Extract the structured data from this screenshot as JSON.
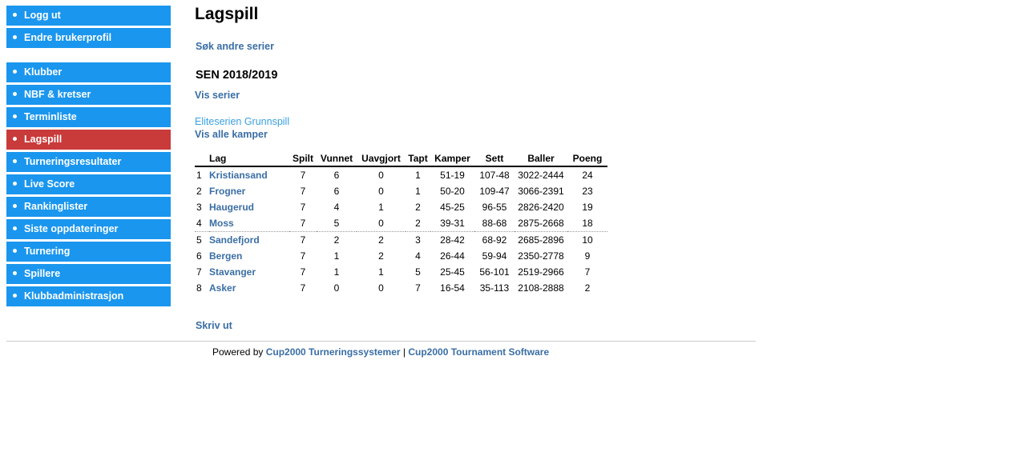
{
  "sidebar": {
    "top_items": [
      {
        "label": "Logg ut"
      },
      {
        "label": "Endre brukerprofil"
      }
    ],
    "items": [
      {
        "label": "Klubber"
      },
      {
        "label": "NBF & kretser"
      },
      {
        "label": "Terminliste"
      },
      {
        "label": "Lagspill",
        "active": true
      },
      {
        "label": "Turneringsresultater"
      },
      {
        "label": "Live Score"
      },
      {
        "label": "Rankinglister"
      },
      {
        "label": "Siste oppdateringer"
      },
      {
        "label": "Turnering"
      },
      {
        "label": "Spillere"
      },
      {
        "label": "Klubbadministrasjon"
      }
    ],
    "colors": {
      "item": "#1a96ee",
      "active": "#c93a3a"
    }
  },
  "main": {
    "title": "Lagspill",
    "search_other_series": "Søk andre serier",
    "season": "SEN 2018/2019",
    "show_series": "Vis serier",
    "series_name": "Eliteserien Grunnspill",
    "show_all_matches": "Vis alle kamper",
    "print": "Skriv ut"
  },
  "standings": {
    "headers": [
      "",
      "Lag",
      "Spilt",
      "Vunnet",
      "Uavgjort",
      "Tapt",
      "Kamper",
      "Sett",
      "Baller",
      "Poeng"
    ],
    "rows": [
      [
        "1",
        "Kristiansand",
        "7",
        "6",
        "0",
        "1",
        "51-19",
        "107-48",
        "3022-2444",
        "24"
      ],
      [
        "2",
        "Frogner",
        "7",
        "6",
        "0",
        "1",
        "50-20",
        "109-47",
        "3066-2391",
        "23"
      ],
      [
        "3",
        "Haugerud",
        "7",
        "4",
        "1",
        "2",
        "45-25",
        "96-55",
        "2826-2420",
        "19"
      ],
      [
        "4",
        "Moss",
        "7",
        "5",
        "0",
        "2",
        "39-31",
        "88-68",
        "2875-2668",
        "18"
      ],
      [
        "5",
        "Sandefjord",
        "7",
        "2",
        "2",
        "3",
        "28-42",
        "68-92",
        "2685-2896",
        "10"
      ],
      [
        "6",
        "Bergen",
        "7",
        "1",
        "2",
        "4",
        "26-44",
        "59-94",
        "2350-2778",
        "9"
      ],
      [
        "7",
        "Stavanger",
        "7",
        "1",
        "1",
        "5",
        "25-45",
        "56-101",
        "2519-2966",
        "7"
      ],
      [
        "8",
        "Asker",
        "7",
        "0",
        "0",
        "7",
        "16-54",
        "35-113",
        "2108-2888",
        "2"
      ]
    ]
  },
  "footer": {
    "prefix": "Powered by ",
    "link1": "Cup2000 Turneringssystemer",
    "separator": " | ",
    "link2": "Cup2000 Tournament Software"
  }
}
